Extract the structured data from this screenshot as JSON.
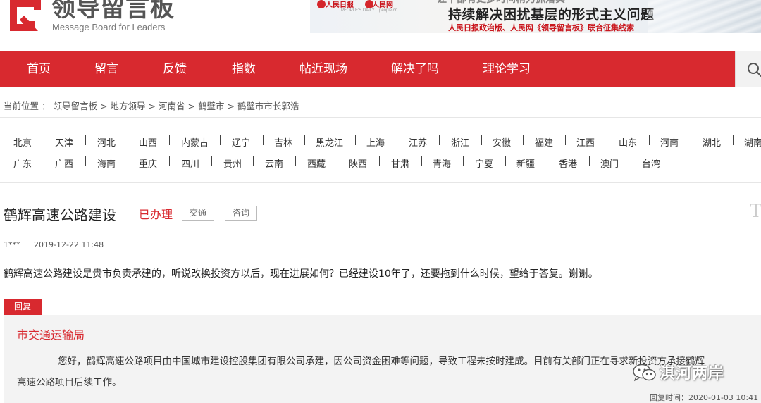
{
  "header": {
    "logo_cn": "领导留言板",
    "logo_en": "Message Board for Leaders",
    "banner": {
      "badge_left": "人民日报",
      "badge_left_en": "PEOPLE'S DAILY",
      "badge_right": "人民网",
      "badge_right_en": "people.cn",
      "title_top": "让干部有更多时间精力抓落实",
      "title": "持续解决困扰基层的形式主义问题",
      "subtitle": "人民日报政治版、人民网《领导留言板》联合征集线索"
    }
  },
  "nav": {
    "items": [
      "首页",
      "留言",
      "反馈",
      "指数",
      "帖近现场",
      "解决了吗",
      "理论学习"
    ],
    "search_icon": "search-icon"
  },
  "breadcrumb": {
    "prefix": "当前位置 ：",
    "items": [
      "领导留言板",
      "地方领导",
      "河南省",
      "鹤壁市",
      "鹤壁市市长郭浩"
    ],
    "separator": ">"
  },
  "regions": {
    "row1": [
      "北京",
      "天津",
      "河北",
      "山西",
      "内蒙古",
      "辽宁",
      "吉林",
      "黑龙江",
      "上海",
      "江苏",
      "浙江",
      "安徽",
      "福建",
      "江西",
      "山东",
      "河南",
      "湖北",
      "湖南"
    ],
    "row2": [
      "广东",
      "广西",
      "海南",
      "重庆",
      "四川",
      "贵州",
      "云南",
      "西藏",
      "陕西",
      "甘肃",
      "青海",
      "宁夏",
      "新疆",
      "香港",
      "澳门",
      "台湾"
    ]
  },
  "message": {
    "title": "鹤辉高速公路建设",
    "status": "已办理",
    "tags": [
      "交通",
      "咨询"
    ],
    "side_glyph": "T",
    "author": "1***",
    "time": "2019-12-22 11:48",
    "body": "鹤辉高速公路建设是贵市负责承建的，听说改换投资方以后，现在进展如何？已经建设10年了，还要拖到什么时候，望给于答复。谢谢。"
  },
  "reply": {
    "tab_label": "回复",
    "org": "市交通运输局",
    "text_line1": "您好，鹤辉高速公路项目由中国城市建设控股集团有限公司承建，因公司资金困难等问题，导致工程未按时建成。目前有关部门正在寻求新投资方承接鹤辉",
    "text_line2": "高速公路项目后续工作。",
    "time_label": "回复时间：2020-01-03 10:41"
  },
  "watermark": {
    "text": "淇河两岸",
    "icon": "wechat-icon"
  },
  "colors": {
    "brand_red": "#d8292f",
    "reply_bg": "#f3f3f3"
  }
}
